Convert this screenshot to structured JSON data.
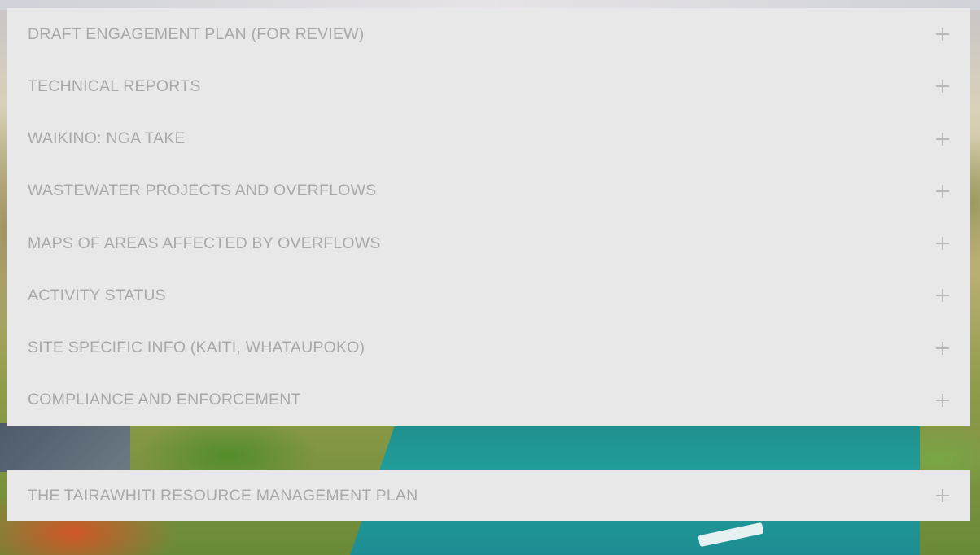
{
  "accordion": {
    "items": [
      {
        "label": "DRAFT ENGAGEMENT PLAN (FOR REVIEW)",
        "icon": "plus-icon"
      },
      {
        "label": "TECHNICAL REPORTS",
        "icon": "plus-icon"
      },
      {
        "label": "WAIKINO: NGA TAKE",
        "icon": "plus-icon"
      },
      {
        "label": "WASTEWATER PROJECTS AND OVERFLOWS",
        "icon": "plus-icon"
      },
      {
        "label": "MAPS OF AREAS AFFECTED BY OVERFLOWS",
        "icon": "plus-icon"
      },
      {
        "label": "ACTIVITY STATUS",
        "icon": "plus-icon"
      },
      {
        "label": "SITE SPECIFIC INFO (KAITI, WHATAUPOKO)",
        "icon": "plus-icon"
      },
      {
        "label": "COMPLIANCE AND ENFORCEMENT",
        "icon": "plus-icon"
      }
    ]
  },
  "secondary_accordion": {
    "label": "THE TAIRAWHITI RESOURCE MANAGEMENT PLAN",
    "icon": "plus-icon"
  },
  "colors": {
    "panel_bg": "#e8e8e8",
    "label_text": "#a9a9a9",
    "icon": "#b8b8b8"
  }
}
